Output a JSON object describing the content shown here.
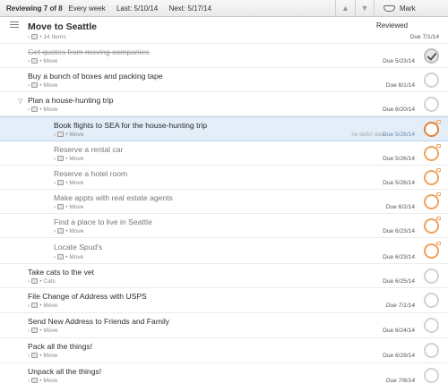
{
  "topbar": {
    "reviewing": "Reviewing 7 of 8",
    "frequency": "Every week",
    "last": "Last: 5/10/14",
    "next": "Next: 5/17/14",
    "mark_reviewed": "Mark Reviewed"
  },
  "project": {
    "title": "Move to Seattle",
    "items": "14 Items",
    "due": "Due 7/1/14"
  },
  "tasks": [
    {
      "title": "Get quotes from moving companies",
      "context": "Move",
      "due": "Due 5/23/14",
      "status": "completed"
    },
    {
      "title": "Buy a bunch of boxes and packing tape",
      "context": "Move",
      "due": "Due 6/1/14",
      "status": "available"
    },
    {
      "title": "Plan a house-hunting trip",
      "context": "Move",
      "due": "Due 6/20/14",
      "status": "group-available"
    },
    {
      "title": "Book flights to SEA for the house-hunting trip",
      "context": "Move",
      "defer": "no defer date",
      "due": "Due 5/26/14",
      "status": "selected-due-soon"
    },
    {
      "title": "Reserve a rental car",
      "context": "Move",
      "due": "Due 5/26/14",
      "status": "due-soon"
    },
    {
      "title": "Reserve a hotel room",
      "context": "Move",
      "due": "Due 5/26/14",
      "status": "due-soon"
    },
    {
      "title": "Make appts with real estate agents",
      "context": "Move",
      "due": "Due 6/2/14",
      "status": "due-soon"
    },
    {
      "title": "Find a place to live in Seattle",
      "context": "Move",
      "due": "Due 6/23/14",
      "status": "due-soon"
    },
    {
      "title": "Locate Spud's",
      "context": "Move",
      "due": "Due 6/23/14",
      "status": "due-soon"
    },
    {
      "title": "Take cats to the vet",
      "context": "Cats",
      "due": "Due 6/25/14",
      "status": "available"
    },
    {
      "title": "File Change of Address with USPS",
      "context": "Move",
      "due": "Due 7/1/14",
      "status": "available"
    },
    {
      "title": "Send New Address to Friends and Family",
      "context": "Move",
      "due": "Due 6/24/14",
      "status": "available"
    },
    {
      "title": "Pack all the things!",
      "context": "Move",
      "due": "Due 6/29/14",
      "status": "available"
    },
    {
      "title": "Unpack all the things!",
      "context": "Move",
      "due": "Due 7/6/14",
      "status": "available"
    }
  ],
  "colors": {
    "due_soon": "#f0a25a",
    "selected_row": "#e3eef9",
    "available_ring": "#d2d2d2"
  },
  "icons": {
    "up": "chevron-up-icon",
    "down": "chevron-down-icon",
    "mark_reviewed": "inbox-tray-icon",
    "project": "project-list-icon"
  }
}
